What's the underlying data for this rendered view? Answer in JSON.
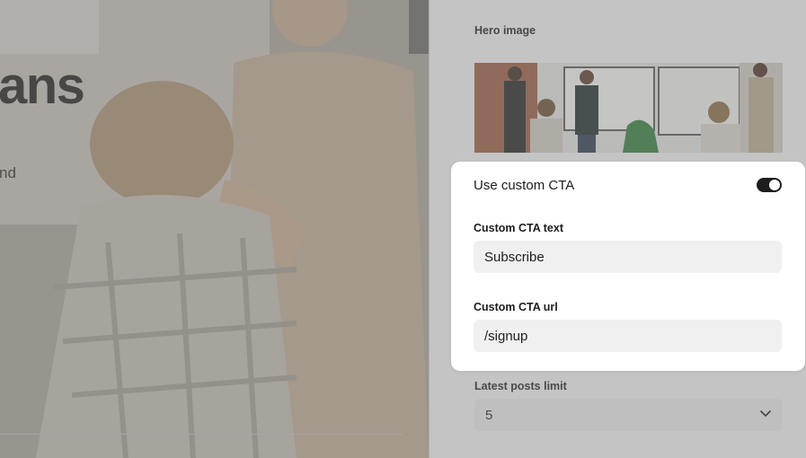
{
  "preview": {
    "headline_fragment": "ans",
    "subtext_fragment": "nd"
  },
  "settings": {
    "hero_image_label": "Hero image",
    "use_custom_cta_label": "Use custom CTA",
    "use_custom_cta_enabled": true,
    "custom_cta_text_label": "Custom CTA text",
    "custom_cta_text_value": "Subscribe",
    "custom_cta_url_label": "Custom CTA url",
    "custom_cta_url_value": "/signup",
    "latest_posts_limit_label": "Latest posts limit",
    "latest_posts_limit_value": "5"
  },
  "icons": {
    "select_arrow": "chevron-down-icon"
  },
  "colors": {
    "accent": "#1d1d1f",
    "card_background": "#ffffff",
    "input_background": "#f0f0f1"
  }
}
